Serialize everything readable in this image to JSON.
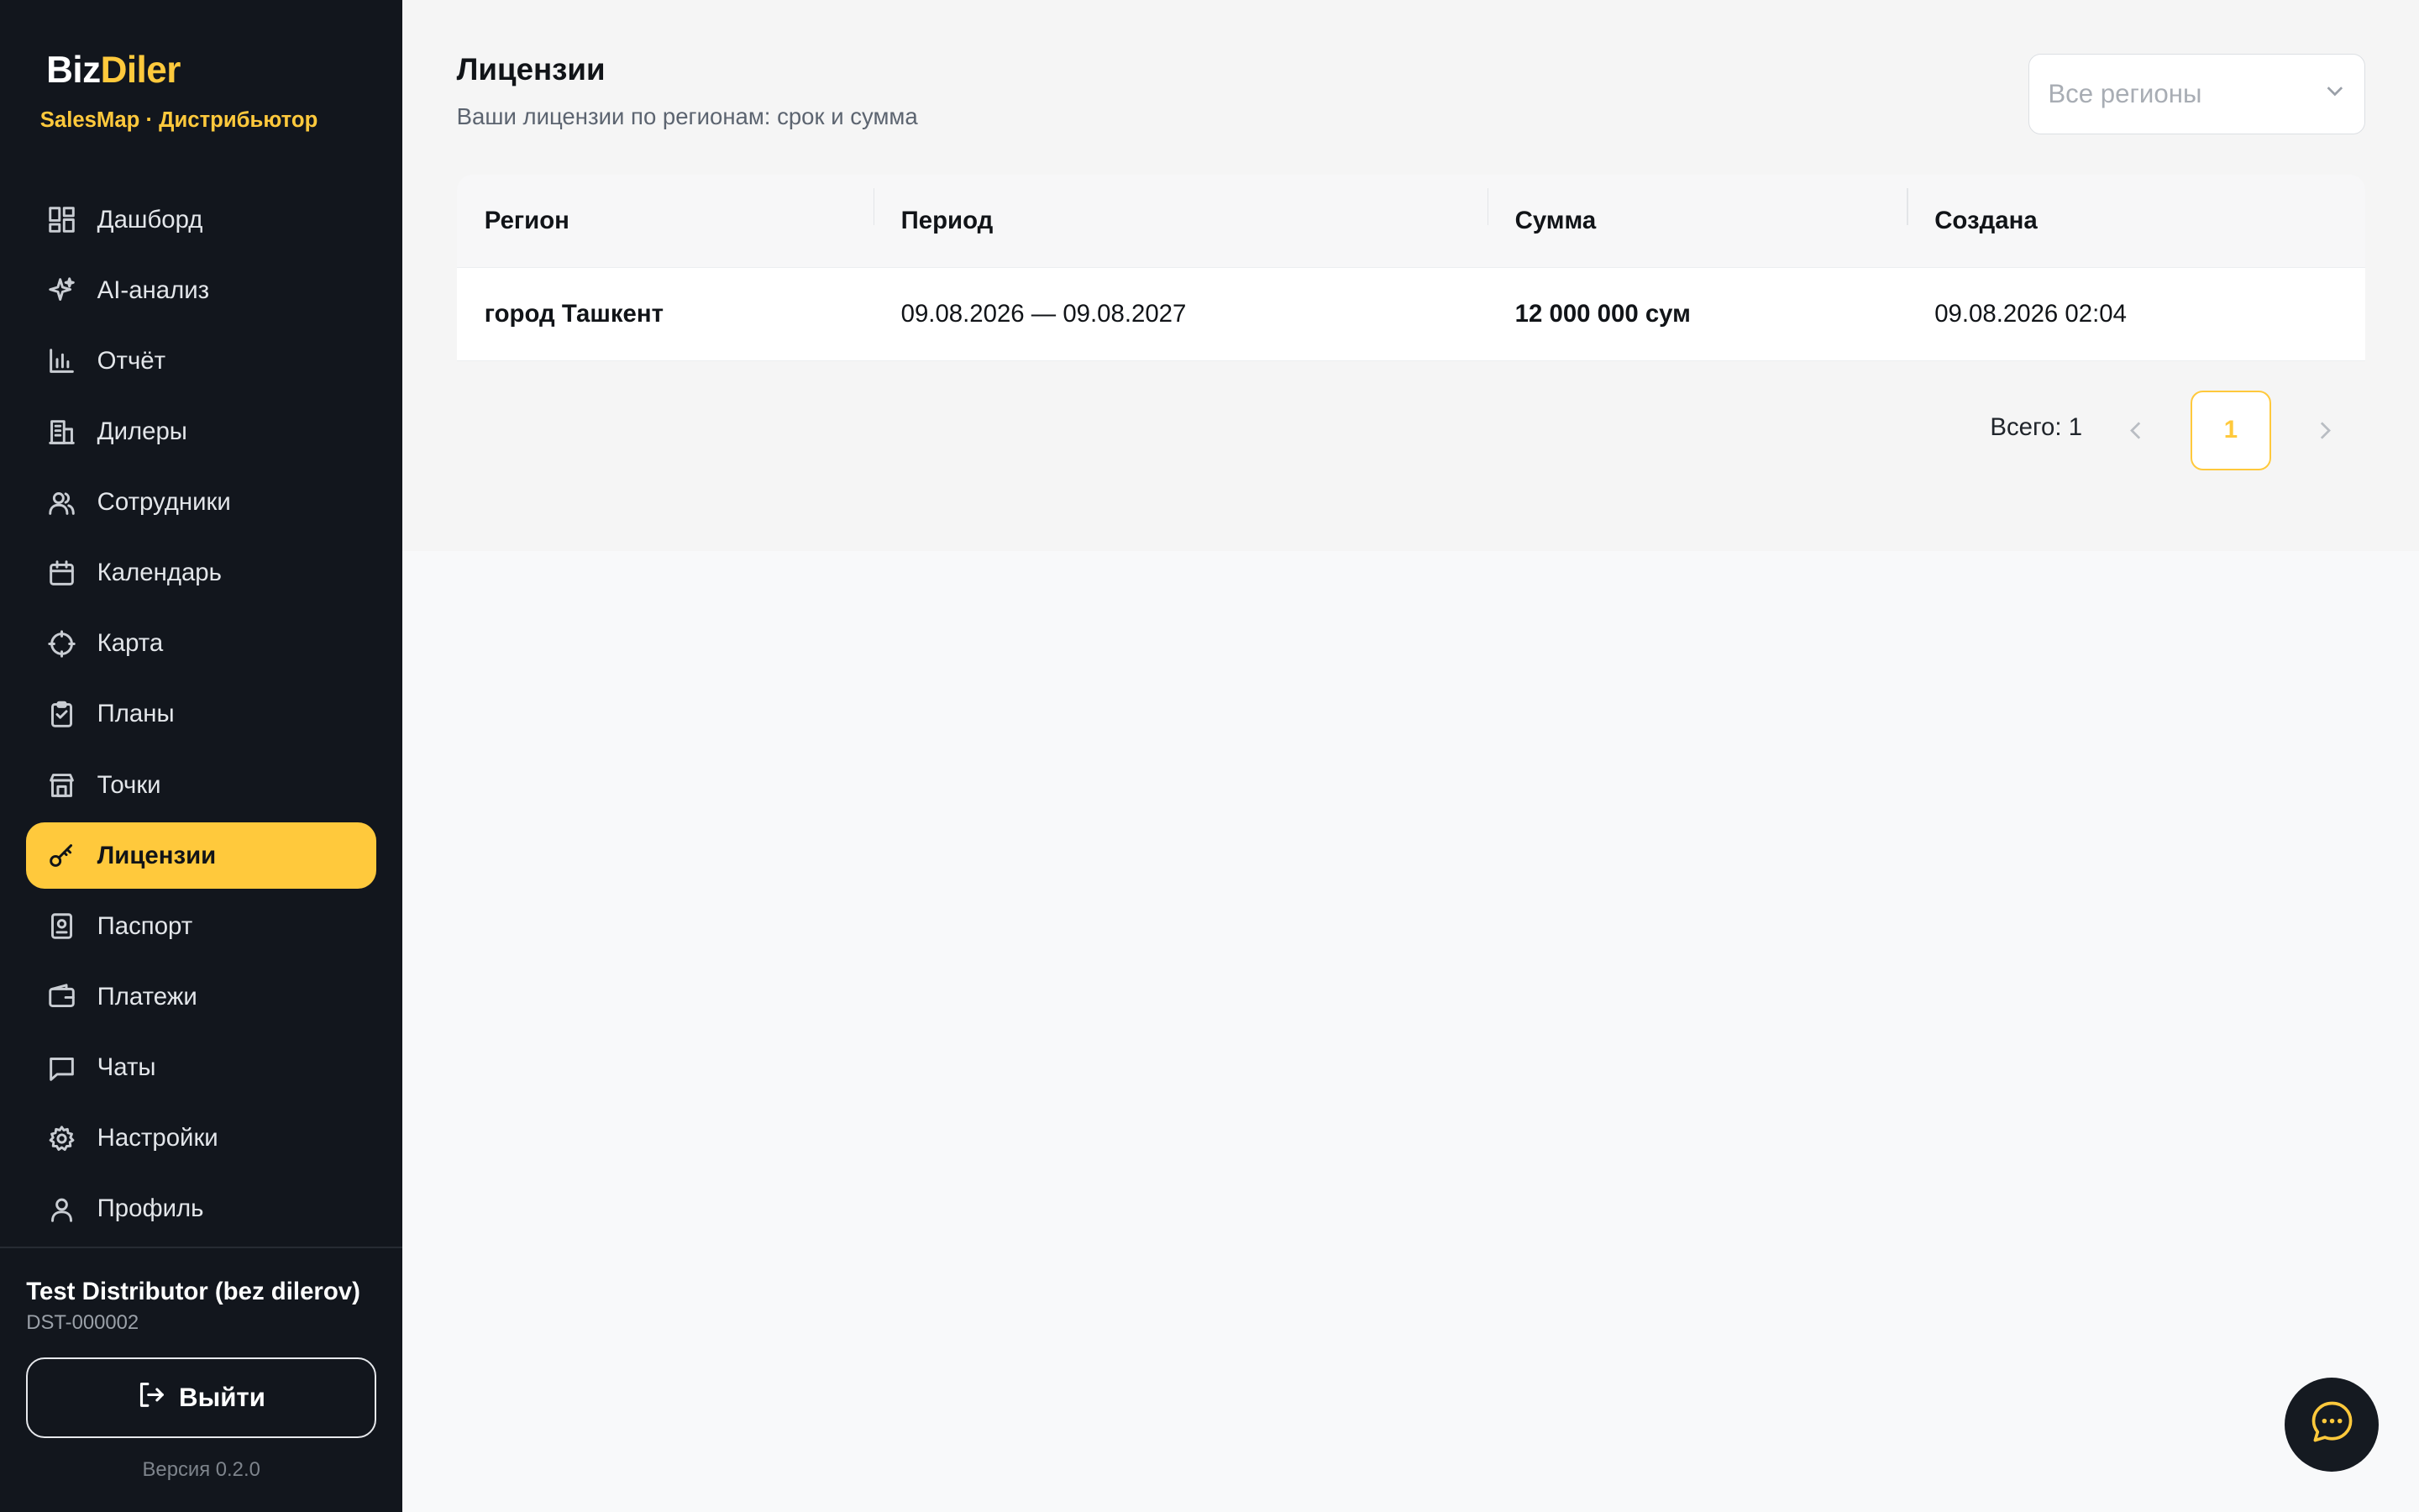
{
  "brand": {
    "part1": "Biz",
    "part2": "Diler",
    "subtitle": "SalesMap · Дистрибьютор"
  },
  "sidebar": {
    "items": [
      {
        "label": "Дашборд",
        "icon": "dashboard-icon"
      },
      {
        "label": "AI-анализ",
        "icon": "sparkle-icon"
      },
      {
        "label": "Отчёт",
        "icon": "bar-chart-icon"
      },
      {
        "label": "Дилеры",
        "icon": "building-icon"
      },
      {
        "label": "Сотрудники",
        "icon": "users-icon"
      },
      {
        "label": "Календарь",
        "icon": "calendar-icon"
      },
      {
        "label": "Карта",
        "icon": "crosshair-icon"
      },
      {
        "label": "Планы",
        "icon": "clipboard-icon"
      },
      {
        "label": "Точки",
        "icon": "store-icon"
      },
      {
        "label": "Лицензии",
        "icon": "key-icon",
        "active": true
      },
      {
        "label": "Паспорт",
        "icon": "passport-icon"
      },
      {
        "label": "Платежи",
        "icon": "wallet-icon"
      },
      {
        "label": "Чаты",
        "icon": "chat-icon"
      },
      {
        "label": "Настройки",
        "icon": "gear-icon"
      },
      {
        "label": "Профиль",
        "icon": "user-icon"
      }
    ]
  },
  "user": {
    "name": "Test Distributor (bez dilerov)",
    "code": "DST-000002"
  },
  "logout_label": "Выйти",
  "version": "Версия 0.2.0",
  "page": {
    "title": "Лицензии",
    "subtitle": "Ваши лицензии по регионам: срок и сумма",
    "region_filter_placeholder": "Все регионы"
  },
  "table": {
    "headers": [
      "Регион",
      "Период",
      "Сумма",
      "Создана"
    ],
    "rows": [
      {
        "region": "город Ташкент",
        "period": "09.08.2026 — 09.08.2027",
        "amount": "12 000 000 сум",
        "created": "09.08.2026 02:04"
      }
    ]
  },
  "pagination": {
    "total": "Всего: 1",
    "current": "1"
  },
  "colors": {
    "accent": "#ffc93c",
    "sidebar_bg": "#12161d"
  }
}
